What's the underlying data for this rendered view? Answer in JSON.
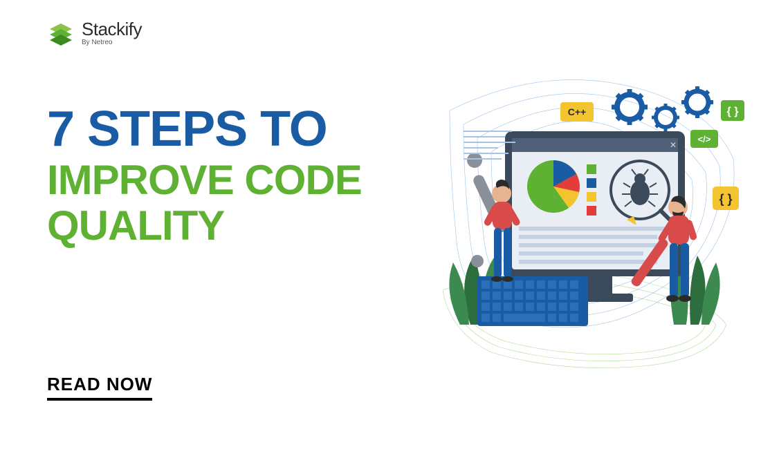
{
  "logo": {
    "brand": "Stackify",
    "byline": "By Netreo"
  },
  "headline": {
    "line1": "7 STEPS TO",
    "line2": "IMPROVE CODE QUALITY"
  },
  "cta": {
    "label": "READ NOW"
  },
  "illustration": {
    "badge1": "C++",
    "badge2": "</>",
    "badge3": "{ }",
    "badge4": "{ }"
  },
  "colors": {
    "primary_blue": "#1a5ca3",
    "primary_green": "#5eb132",
    "text_black": "#000000"
  }
}
